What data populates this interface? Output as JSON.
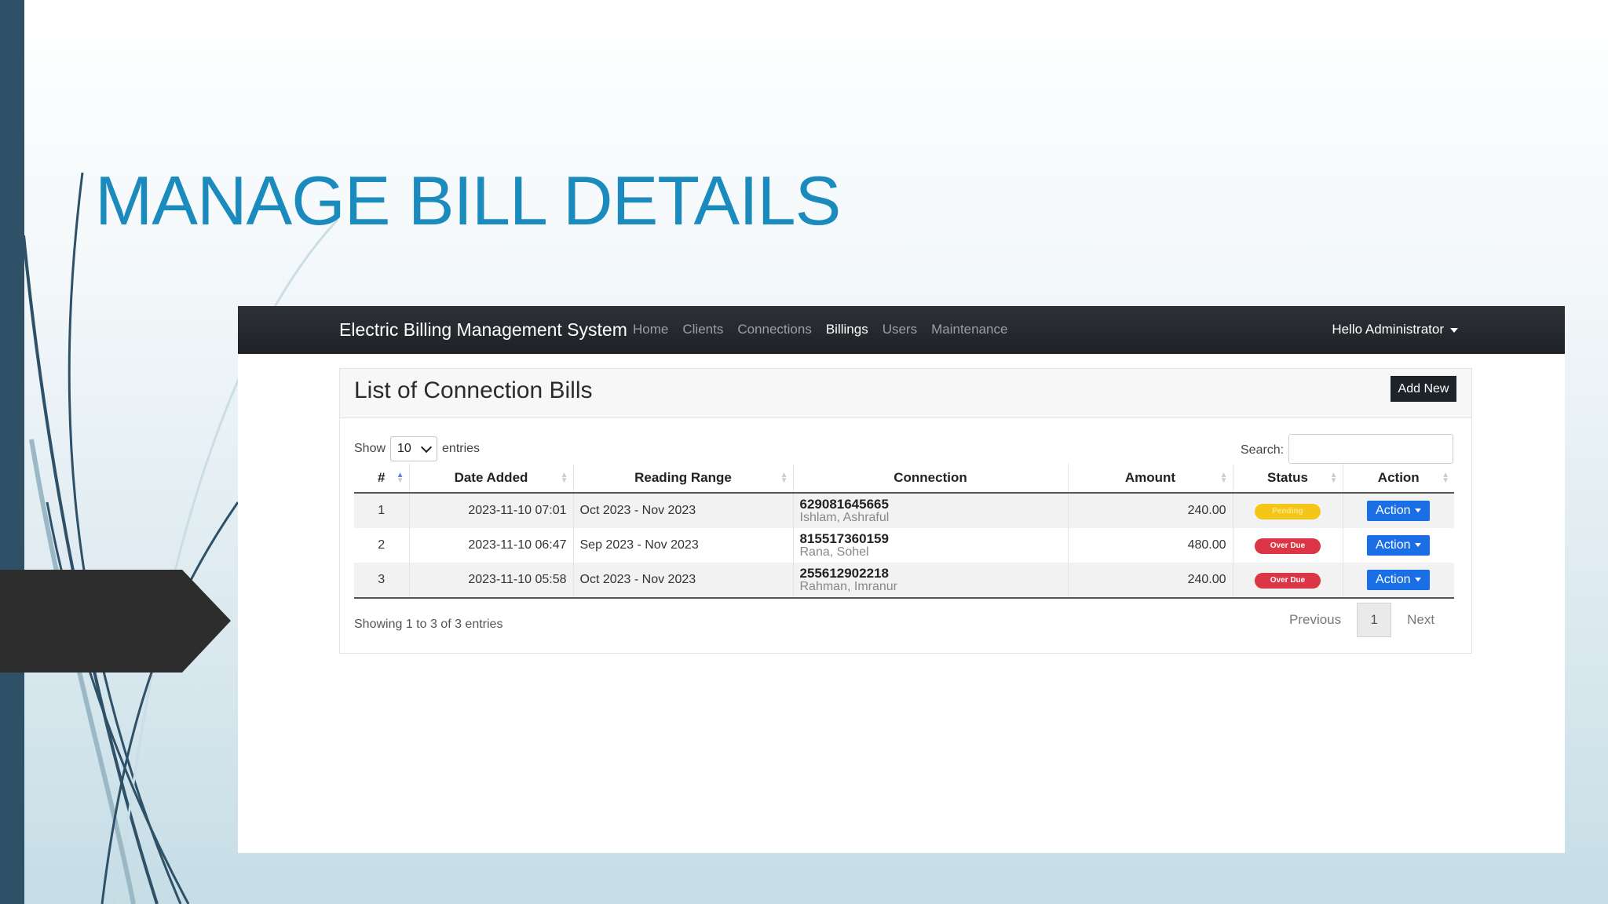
{
  "slide": {
    "title": "MANAGE BILL DETAILS"
  },
  "navbar": {
    "brand": "Electric Billing Management System",
    "links": [
      "Home",
      "Clients",
      "Connections",
      "Billings",
      "Users",
      "Maintenance"
    ],
    "active_link": "Billings",
    "user_menu": "Hello Administrator"
  },
  "card": {
    "title": "List of Connection Bills",
    "add_new": "Add New"
  },
  "controls": {
    "show_label": "Show",
    "entries_value": "10",
    "entries_label": "entries",
    "search_label": "Search:",
    "search_value": ""
  },
  "table": {
    "headers": [
      "#",
      "Date Added",
      "Reading Range",
      "Connection",
      "Amount",
      "Status",
      "Action"
    ],
    "rows": [
      {
        "num": "1",
        "date": "2023-11-10 07:01",
        "range": "Oct 2023 - Nov 2023",
        "code": "629081645665",
        "name": "Ishlam, Ashraful",
        "amount": "240.00",
        "status": "Pending",
        "action": "Action"
      },
      {
        "num": "2",
        "date": "2023-11-10 06:47",
        "range": "Sep 2023 - Nov 2023",
        "code": "815517360159",
        "name": "Rana, Sohel",
        "amount": "480.00",
        "status": "Over Due",
        "action": "Action"
      },
      {
        "num": "3",
        "date": "2023-11-10 05:58",
        "range": "Oct 2023 - Nov 2023",
        "code": "255612902218",
        "name": "Rahman, Imranur",
        "amount": "240.00",
        "status": "Over Due",
        "action": "Action"
      }
    ]
  },
  "footer": {
    "info": "Showing 1 to 3 of 3 entries",
    "previous": "Previous",
    "page": "1",
    "next": "Next"
  },
  "colors": {
    "title_blue": "#1b8bbd",
    "navbar_dark": "#212529",
    "pending_yellow": "#f5c518",
    "overdue_red": "#dc3545",
    "action_blue": "#1a6fe6"
  }
}
